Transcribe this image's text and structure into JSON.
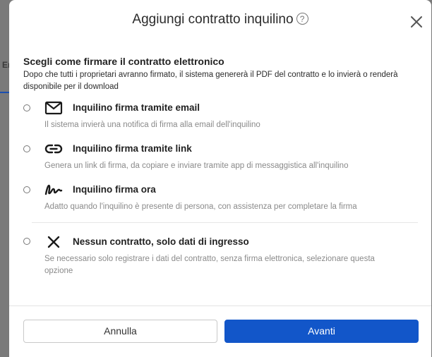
{
  "background": {
    "tab_label": "En"
  },
  "modal": {
    "title": "Aggiungi contratto inquilino",
    "help_glyph": "?",
    "section_title": "Scegli come firmare il contratto elettronico",
    "section_desc": "Dopo che tutti i proprietari avranno firmato, il sistema genererà il PDF del contratto e lo invierà o renderà disponibile per il download",
    "options": [
      {
        "icon": "envelope-icon",
        "label": "Inquilino firma tramite email",
        "desc": "Il sistema invierà una notifica di firma alla email dell'inquilino"
      },
      {
        "icon": "link-icon",
        "label": "Inquilino firma tramite link",
        "desc": "Genera un link di firma, da copiare e inviare tramite app di messaggistica all'inquilino"
      },
      {
        "icon": "signature-icon",
        "label": "Inquilino firma ora",
        "desc": "Adatto quando l'inquilino è presente di persona, con assistenza per completare la firma"
      },
      {
        "icon": "x-icon",
        "label": "Nessun contratto, solo dati di ingresso",
        "desc": "Se necessario solo registrare i dati del contratto, senza firma elettronica, selezionare questa opzione"
      }
    ],
    "buttons": {
      "cancel": "Annulla",
      "next": "Avanti"
    }
  },
  "colors": {
    "primary": "#1256c9",
    "overlay": "#6f6f6f"
  }
}
